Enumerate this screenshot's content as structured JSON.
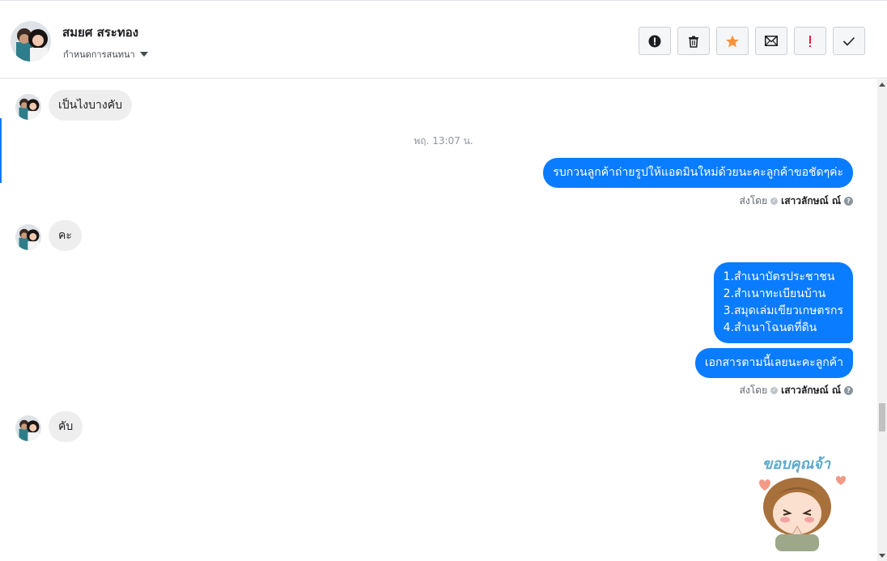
{
  "header": {
    "contact_name": "สมยศ สระทอง",
    "label_select": "กำหนดการสนทนา",
    "actions": [
      {
        "name": "spam-button",
        "icon": "alert-circle-icon"
      },
      {
        "name": "delete-button",
        "icon": "trash-icon"
      },
      {
        "name": "star-button",
        "icon": "star-icon",
        "color": "#f7923b"
      },
      {
        "name": "mark-unread-button",
        "icon": "envelope-icon"
      },
      {
        "name": "priority-button",
        "icon": "exclamation-icon",
        "color": "#e41e3f"
      },
      {
        "name": "done-button",
        "icon": "check-icon"
      }
    ]
  },
  "thread": {
    "msg1": "เป็นไงบางคับ",
    "timestamp": "พฤ. 13:07 น.",
    "msg2": "รบกวนลูกค้าถ่ายรูปให้แอดมินใหม่ด้วยนะคะลูกค้าขอชัดๆค่ะ",
    "sent_by_prefix": "ส่งโดย",
    "sender": "เสาวลักษณ์ ณ์",
    "msg3": "คะ",
    "msg4_lines": [
      "1.สำเนาบัตรประชาชน",
      "2.สำเนาทะเบียนบ้าน",
      "3.สมุดเล่มเขียวเกษตรกร",
      "4.สำเนาโฉนดที่ดิน"
    ],
    "msg5": "เอกสารตามนี้เลยนะคะลูกค้า",
    "msg6": "คับ",
    "sticker_text": "ขอบคุณจ้า"
  },
  "colors": {
    "outgoing_bubble": "#0a7cff",
    "incoming_bubble": "#eeeeee",
    "accent": "#1877f2"
  }
}
